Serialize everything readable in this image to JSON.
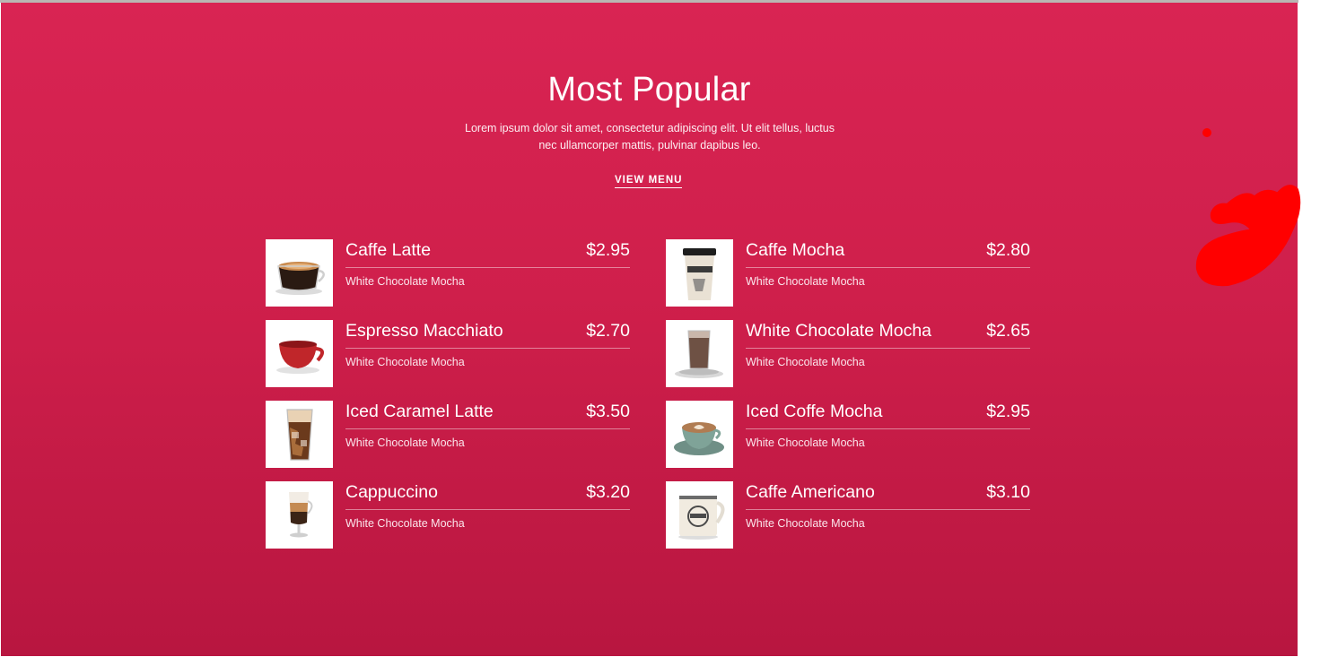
{
  "section": {
    "title": "Most Popular",
    "description_line1": "Lorem ipsum dolor sit amet, consectetur adipiscing elit. Ut elit tellus, luctus",
    "description_line2": "nec ullamcorper mattis, pulvinar dapibus leo.",
    "view_menu_label": "VIEW MENU"
  },
  "colors": {
    "background_top": "#d92453",
    "background_bottom": "#b81640",
    "text": "#ffffff"
  },
  "menu": {
    "left": [
      {
        "name": "Caffe Latte",
        "price": "$2.95",
        "subtitle": "White Chocolate Mocha",
        "icon": "latte-glass-cup-icon"
      },
      {
        "name": "Espresso Macchiato",
        "price": "$2.70",
        "subtitle": "White Chocolate Mocha",
        "icon": "red-cup-icon"
      },
      {
        "name": "Iced Caramel Latte",
        "price": "$3.50",
        "subtitle": "White Chocolate Mocha",
        "icon": "iced-glass-icon"
      },
      {
        "name": "Cappuccino",
        "price": "$3.20",
        "subtitle": "White Chocolate Mocha",
        "icon": "irish-coffee-glass-icon"
      }
    ],
    "right": [
      {
        "name": "Caffe Mocha",
        "price": "$2.80",
        "subtitle": "White Chocolate Mocha",
        "icon": "takeaway-cup-icon"
      },
      {
        "name": "White Chocolate Mocha",
        "price": "$2.65",
        "subtitle": "White Chocolate Mocha",
        "icon": "glass-on-saucer-icon"
      },
      {
        "name": "Iced Coffe Mocha",
        "price": "$2.95",
        "subtitle": "White Chocolate Mocha",
        "icon": "latte-art-cup-icon"
      },
      {
        "name": "Caffe Americano",
        "price": "$3.10",
        "subtitle": "White Chocolate Mocha",
        "icon": "enamel-mug-icon"
      }
    ]
  }
}
